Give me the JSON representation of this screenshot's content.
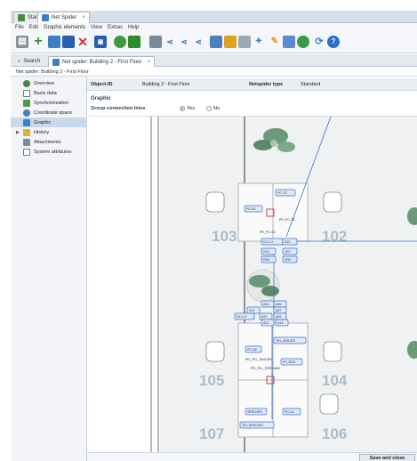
{
  "window_tabs": [
    {
      "label": "Start",
      "active": false
    },
    {
      "label": "Net Spider",
      "active": true
    }
  ],
  "menu": [
    "File",
    "Edit",
    "Graphic elements",
    "View",
    "Extras",
    "Help"
  ],
  "toolbar_icons": [
    "printer-icon",
    "add-icon",
    "copy-icon",
    "save-icon",
    "delete-icon",
    "properties-icon",
    "export-icon",
    "layers-icon",
    "graph-icon",
    "connect-icon",
    "connect-2-icon",
    "connect-3-icon",
    "network-icon",
    "chart-icon",
    "camera-icon",
    "satellite-icon",
    "edit-icon",
    "document-icon",
    "gear-icon",
    "refresh-icon",
    "help-icon"
  ],
  "content_tabs": [
    {
      "label": "Search",
      "active": false
    },
    {
      "label": "Net spider: Building 2 - First Floor",
      "active": true
    }
  ],
  "breadcrumb": "Net spider: Building 2 - First Floor",
  "sidebar": {
    "items": [
      {
        "label": "Overview",
        "icon": "overview-icon",
        "selected": false,
        "expandable": false
      },
      {
        "label": "Basic data",
        "icon": "document-icon",
        "selected": false,
        "expandable": false
      },
      {
        "label": "Synchronization",
        "icon": "sync-icon",
        "selected": false,
        "expandable": false
      },
      {
        "label": "Coordinate space",
        "icon": "coordinate-icon",
        "selected": false,
        "expandable": false
      },
      {
        "label": "Graphic",
        "icon": "graphic-icon",
        "selected": true,
        "expandable": false
      },
      {
        "label": "History",
        "icon": "history-icon",
        "selected": false,
        "expandable": true
      },
      {
        "label": "Attachments",
        "icon": "attachment-icon",
        "selected": false,
        "expandable": false
      },
      {
        "label": "System attributes",
        "icon": "system-icon",
        "selected": false,
        "expandable": false
      }
    ]
  },
  "header": {
    "object_id_label": "Object-ID",
    "object_id_value": "Building 2 - First Floor",
    "type_label": "Netspider type",
    "type_value": "Standard"
  },
  "graphic": {
    "section_title": "Graphic",
    "group_label": "Group connection lines",
    "yes_label": "Yes",
    "no_label": "No",
    "selected": "Yes"
  },
  "floorplan": {
    "rooms": [
      "103",
      "102",
      "105",
      "104",
      "107",
      "106"
    ],
    "devices": [
      "PC-T3",
      "PC-S2",
      "PR_PC-T3",
      "PR_PC-S2",
      "D2-1-X",
      "D21",
      "D10",
      "D07",
      "D08",
      "D06",
      "A34",
      "A36",
      "A19",
      "A37",
      "A20",
      "A33",
      "D2-1-X",
      "A21",
      "A13",
      "TEL-UNILIDE",
      "PC-N2",
      "PR_TEL_UNILIDE",
      "PC-2003",
      "PR_TEL_SIPE-NAN",
      "SIPE-NPD",
      "PC-OL",
      "TEL-SIPE-NST"
    ]
  },
  "footer": {
    "save_label": "Save and close"
  }
}
